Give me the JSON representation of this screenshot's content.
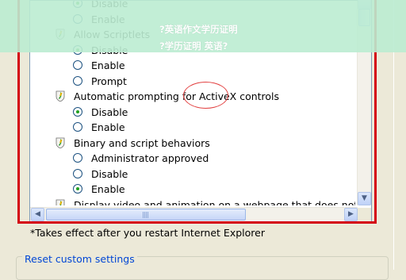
{
  "settings_list": {
    "rows": [
      {
        "kind": "option",
        "label": "Disable",
        "selected": true
      },
      {
        "kind": "option",
        "label": "Enable",
        "selected": false
      },
      {
        "kind": "category",
        "label": "Allow Scriptlets",
        "icon": "settings-shield-icon"
      },
      {
        "kind": "option",
        "label": "Disable",
        "selected": true
      },
      {
        "kind": "option",
        "label": "Enable",
        "selected": false
      },
      {
        "kind": "option",
        "label": "Prompt",
        "selected": false
      },
      {
        "kind": "category",
        "label": "Automatic prompting for ActiveX controls",
        "icon": "settings-shield-icon"
      },
      {
        "kind": "option",
        "label": "Disable",
        "selected": true
      },
      {
        "kind": "option",
        "label": "Enable",
        "selected": false
      },
      {
        "kind": "category",
        "label": "Binary and script behaviors",
        "icon": "settings-shield-icon"
      },
      {
        "kind": "option",
        "label": "Administrator approved",
        "selected": false
      },
      {
        "kind": "option",
        "label": "Disable",
        "selected": false
      },
      {
        "kind": "option",
        "label": "Enable",
        "selected": true
      },
      {
        "kind": "category",
        "label": "Display video and animation on a webpage that does not use",
        "icon": "settings-shield-icon"
      }
    ]
  },
  "note": "*Takes effect after you restart Internet Explorer",
  "reset_group_title": "Reset custom settings",
  "banner": {
    "line1": "?英语作文学历证明",
    "line2": "?学历证明 英语?"
  },
  "colors": {
    "highlight_box": "#d40012",
    "radio_selected": "#21a121",
    "banner_bg": "#bbecd2"
  }
}
